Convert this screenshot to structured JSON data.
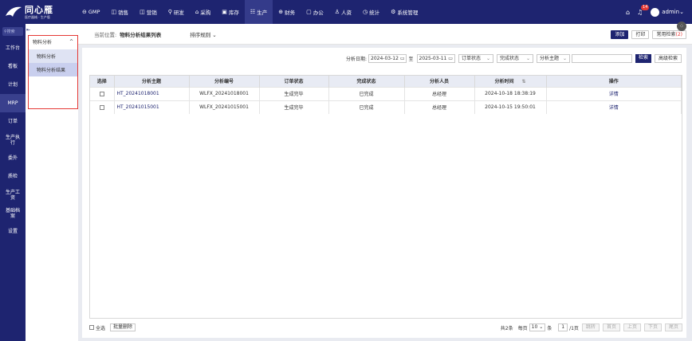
{
  "logo": {
    "name": "同心雁",
    "tagline": "医疗器械 · 生产版"
  },
  "nav": [
    {
      "icon": "⊖",
      "label": "GMP"
    },
    {
      "icon": "◫",
      "label": "销售"
    },
    {
      "icon": "◫",
      "label": "营销"
    },
    {
      "icon": "⚲",
      "label": "研发"
    },
    {
      "icon": "⌂",
      "label": "采购"
    },
    {
      "icon": "▣",
      "label": "库存"
    },
    {
      "icon": "☷",
      "label": "生产"
    },
    {
      "icon": "⊕",
      "label": "财务"
    },
    {
      "icon": "▢",
      "label": "办公"
    },
    {
      "icon": "♙",
      "label": "人资"
    },
    {
      "icon": "◷",
      "label": "统计"
    },
    {
      "icon": "⚙",
      "label": "系统管理"
    }
  ],
  "user": {
    "badge": "14",
    "name": "admin"
  },
  "sidebar": {
    "search_placeholder": "搜索",
    "items": [
      "工作台",
      "看板",
      "计划",
      "MRP",
      "订单",
      "生产执行",
      "委外",
      "质检",
      "生产工资",
      "基础档案",
      "设置"
    ]
  },
  "submenu": {
    "title": "物料分析",
    "items": [
      "物料分析",
      "物料分析结果"
    ]
  },
  "header": {
    "crumb_label": "当前位置:",
    "crumb_page": "物料分析结果列表",
    "sort_label": "排序规则",
    "add": "添加",
    "print": "打印",
    "common_search": "常用检索",
    "common_count": "(2)"
  },
  "filter": {
    "date_label": "分析日期:",
    "date_from": "2024-03-12",
    "date_sep": "至",
    "date_to": "2025-03-11",
    "order_status": "订单状态",
    "complete_status": "完成状态",
    "subject": "分析主题",
    "keyword_placeholder": "",
    "search": "检索",
    "advanced": "高级检索"
  },
  "table": {
    "headers": [
      "选择",
      "分析主题",
      "分析编号",
      "订单状态",
      "完成状态",
      "分析人员",
      "分析时间",
      "操作"
    ],
    "rows": [
      {
        "subject": "HT_20241018001",
        "code": "WLFX_20241018001",
        "order_status": "生成完毕",
        "complete_status": "已完成",
        "person": "总经理",
        "time": "2024-10-18 18:38:19",
        "action": "详情"
      },
      {
        "subject": "HT_20241015001",
        "code": "WLFX_20241015001",
        "order_status": "生成完毕",
        "complete_status": "已完成",
        "person": "总经理",
        "time": "2024-10-15 19:50:01",
        "action": "详情"
      }
    ]
  },
  "footer": {
    "select_all": "全选",
    "batch_delete": "批量删除",
    "total": "共2条",
    "per_page": "每页",
    "page_size": "10",
    "unit": "条",
    "page": "1",
    "pages": "/1页",
    "btn_jump": "跳转",
    "btn_first": "首页",
    "btn_prev": "上页",
    "btn_next": "下页",
    "btn_last": "尾页"
  }
}
